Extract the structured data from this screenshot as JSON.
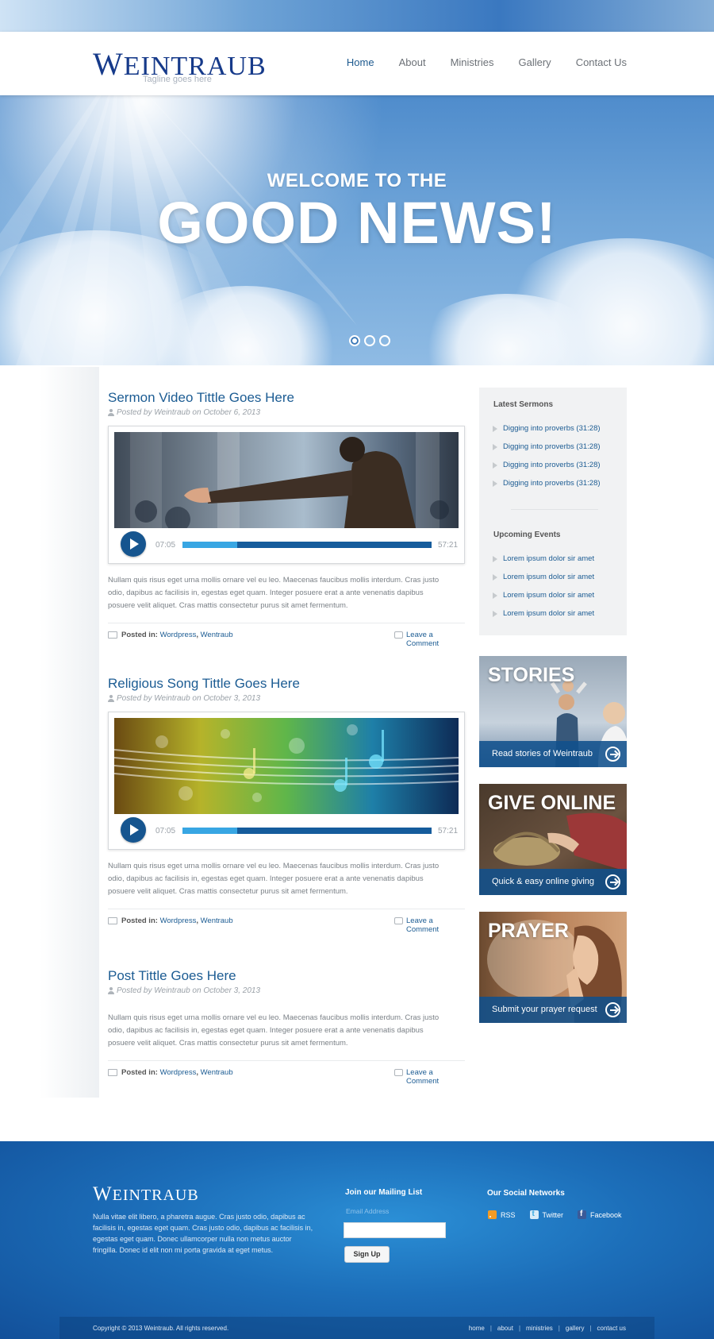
{
  "brand": {
    "name": "Weintraub",
    "tagline": "Tagline goes here"
  },
  "nav": [
    {
      "label": "Home",
      "active": true
    },
    {
      "label": "About"
    },
    {
      "label": "Ministries"
    },
    {
      "label": "Gallery"
    },
    {
      "label": "Contact Us"
    }
  ],
  "hero": {
    "subtitle": "WELCOME TO THE",
    "title": "GOOD NEWS!",
    "slides": 3,
    "active_slide": 1
  },
  "posts": [
    {
      "title": "Sermon Video Tittle Goes Here",
      "meta": "Posted by Weintraub on October 6, 2013",
      "media": "video",
      "player": {
        "current": "07:05",
        "total": "57:21",
        "progress_percent": 22
      },
      "excerpt": "Nullam quis risus eget urna mollis ornare vel eu leo. Maecenas faucibus mollis interdum. Cras justo odio, dapibus ac facilisis in, egestas eget quam. Integer posuere erat a ante venenatis dapibus posuere velit aliquet. Cras mattis consectetur purus sit amet fermentum.",
      "posted_in_label": "Posted in:",
      "categories": [
        "Wordpress",
        "Wentraub"
      ],
      "comment_label": "Leave a Comment"
    },
    {
      "title": "Religious Song Tittle Goes Here",
      "meta": "Posted by Weintraub on October 3, 2013",
      "media": "audio",
      "player": {
        "current": "07:05",
        "total": "57:21",
        "progress_percent": 22
      },
      "excerpt": "Nullam quis risus eget urna mollis ornare vel eu leo. Maecenas faucibus mollis interdum. Cras justo odio, dapibus ac facilisis in, egestas eget quam. Integer posuere erat a ante venenatis dapibus posuere velit aliquet. Cras mattis consectetur purus sit amet fermentum.",
      "posted_in_label": "Posted in:",
      "categories": [
        "Wordpress",
        "Wentraub"
      ],
      "comment_label": "Leave a Comment"
    },
    {
      "title": "Post Tittle Goes Here",
      "meta": "Posted by Weintraub on October 3, 2013",
      "excerpt": "Nullam quis risus eget urna mollis ornare vel eu leo. Maecenas faucibus mollis interdum. Cras justo odio, dapibus ac facilisis in, egestas eget quam. Integer posuere erat a ante venenatis dapibus posuere velit aliquet. Cras mattis consectetur purus sit amet fermentum.",
      "posted_in_label": "Posted in:",
      "categories": [
        "Wordpress",
        "Wentraub"
      ],
      "comment_label": "Leave a Comment"
    }
  ],
  "sidebar": {
    "latest_sermons": {
      "title": "Latest Sermons",
      "items": [
        "Digging into proverbs (31:28)",
        "Digging into proverbs (31:28)",
        "Digging into proverbs (31:28)",
        "Digging into proverbs (31:28)"
      ]
    },
    "upcoming_events": {
      "title": "Upcoming Events",
      "items": [
        "Lorem ipsum dolor sir amet",
        "Lorem ipsum dolor sir amet",
        "Lorem ipsum dolor sir amet",
        "Lorem ipsum dolor sir amet"
      ]
    },
    "promos": [
      {
        "title": "STORIES",
        "caption": "Read stories of Weintraub"
      },
      {
        "title": "GIVE ONLINE",
        "caption": "Quick & easy online giving"
      },
      {
        "title": "PRAYER",
        "caption": "Submit your prayer request"
      }
    ]
  },
  "footer": {
    "logo": "Weintraub",
    "about": "Nulla vitae elit libero, a pharetra augue. Cras justo odio, dapibus ac facilisis in, egestas eget quam. Cras justo odio, dapibus ac facilisis in, egestas eget quam. Donec ullamcorper nulla non metus auctor fringilla. Donec id elit non mi porta gravida at eget metus.",
    "mailing": {
      "title": "Join our Mailing List",
      "placeholder": "Email Address",
      "button": "Sign Up"
    },
    "social": {
      "title": "Our Social Networks",
      "links": [
        "RSS",
        "Twitter",
        "Facebook"
      ]
    },
    "copyright": "Copyright © 2013 Weintraub. All rights reserved.",
    "links": [
      "home",
      "about",
      "ministries",
      "gallery",
      "contact us"
    ]
  },
  "colors": {
    "brand_blue": "#163a8a",
    "link_blue": "#1c5c93",
    "player_blue": "#16558f",
    "progress": "#38a6e3"
  }
}
